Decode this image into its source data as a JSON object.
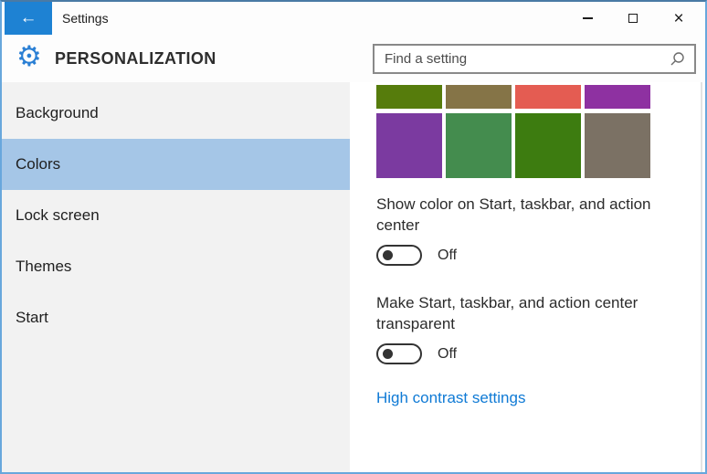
{
  "window": {
    "title": "Settings",
    "border_color": "#68a7dc",
    "accent_color": "#1e82d3"
  },
  "icons": {
    "back_glyph": "←",
    "gear_glyph": "⚙",
    "close_glyph": "×",
    "minimize_name": "minimize-icon",
    "maximize_name": "maximize-icon",
    "search_name": "search-icon"
  },
  "header": {
    "title": "PERSONALIZATION",
    "search": {
      "placeholder": "Find a setting",
      "value": ""
    }
  },
  "sidebar": {
    "selected_color": "#a5c6e7",
    "items": [
      {
        "label": "Background",
        "selected": false
      },
      {
        "label": "Colors",
        "selected": true
      },
      {
        "label": "Lock screen",
        "selected": false
      },
      {
        "label": "Themes",
        "selected": false
      },
      {
        "label": "Start",
        "selected": false
      }
    ]
  },
  "content": {
    "swatch_rows": {
      "partial_top": [
        "#567c0c",
        "#857447",
        "#e45c52",
        "#8e31a1"
      ],
      "full": [
        "#7b3aa0",
        "#448c4e",
        "#3d7c10",
        "#7b7164"
      ]
    },
    "toggles": [
      {
        "label": "Show color on Start, taskbar, and action center",
        "state": "Off"
      },
      {
        "label": "Make Start, taskbar, and action center transparent",
        "state": "Off"
      }
    ],
    "link": {
      "label": "High contrast settings",
      "color": "#0f7ad5"
    }
  }
}
